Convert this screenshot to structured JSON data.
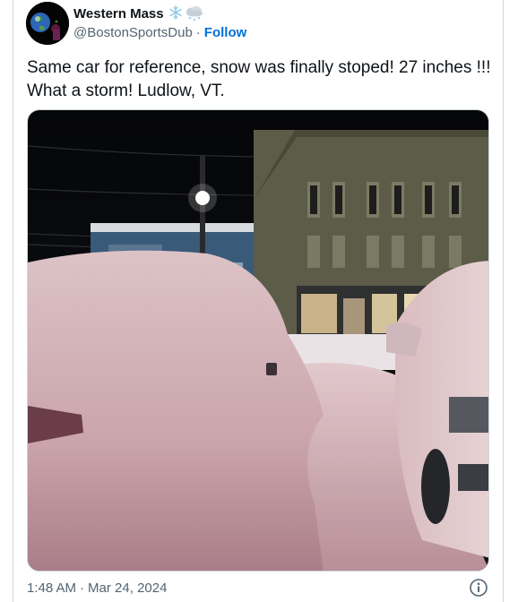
{
  "author": {
    "display_name": "Western Mass",
    "emoji_icons": [
      "snowflake-icon",
      "snow-cloud-icon"
    ],
    "handle": "@BostonSportsDub",
    "separator": "·",
    "follow_label": "Follow"
  },
  "tweet": {
    "text": "Same car for reference, snow was finally stoped! 27 inches !!! What a storm! Ludlow, VT."
  },
  "media": {
    "photo_subject": "snow-covered-car-night-street-photo"
  },
  "meta": {
    "time": "1:48 AM",
    "separator": "·",
    "date": "Mar 24, 2024"
  },
  "colors": {
    "follow_blue": "#006fd6",
    "secondary_text": "#536471",
    "border": "#cfd9de"
  }
}
